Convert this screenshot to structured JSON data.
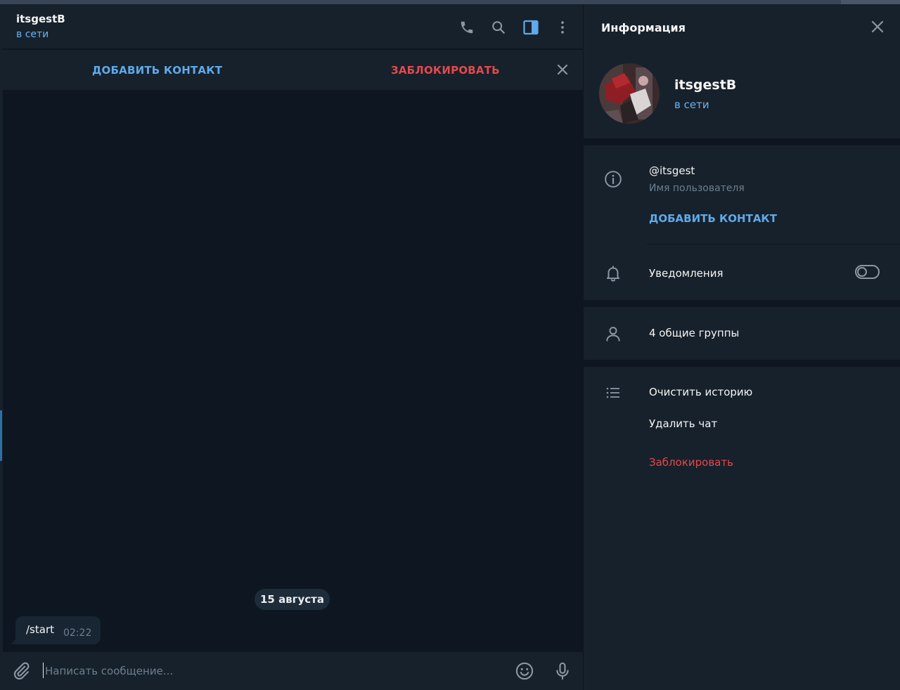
{
  "chat": {
    "header": {
      "title": "itsgestB",
      "status": "в сети",
      "icons": [
        "phone-icon",
        "search-icon",
        "sidebar-toggle-icon",
        "more-vertical-icon"
      ]
    },
    "action_bar": {
      "add_contact": "ДОБАВИТЬ КОНТАКТ",
      "block": "ЗАБЛОКИРОВАТЬ"
    },
    "date_divider": "15 августа",
    "messages": [
      {
        "text": "/start",
        "time": "02:22"
      }
    ],
    "composer": {
      "placeholder": "Написать сообщение...",
      "value": ""
    }
  },
  "info_panel": {
    "title": "Информация",
    "profile": {
      "name": "itsgestB",
      "status": "в сети"
    },
    "username": {
      "value": "@itsgest",
      "label": "Имя пользователя"
    },
    "add_contact": "ДОБАВИТЬ КОНТАКТ",
    "notifications": {
      "label": "Уведомления",
      "enabled": false
    },
    "common_groups": "4 общие группы",
    "actions": {
      "clear_history": "Очистить историю",
      "delete_chat": "Удалить чат",
      "block": "Заблокировать"
    }
  },
  "colors": {
    "accent": "#5eaaeb",
    "status_online": "#6ab3f3",
    "danger": "#e5484d",
    "panel_bg": "#17212b",
    "chat_bg": "#0e1621",
    "active_icon": "#5eaaeb"
  }
}
